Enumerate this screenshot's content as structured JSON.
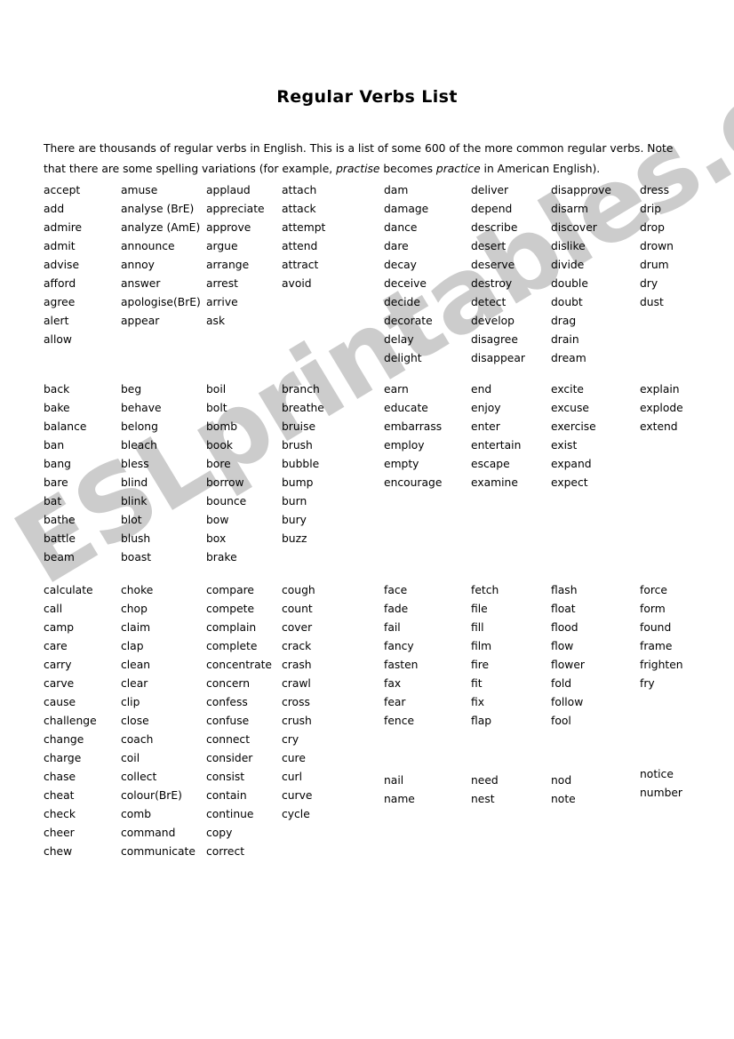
{
  "document": {
    "title": "Regular Verbs List",
    "intro": {
      "part1": "There are thousands of regular verbs in English. This is a list of some 600 of the more common regular verbs. Note that there are some spelling variations (for example, ",
      "italic1": "practise",
      "part2": " becomes ",
      "italic2": "practice",
      "part3": " in American English)."
    },
    "watermark": "ESLprintables.com",
    "watermark_color": "#cccccc"
  },
  "blocks": [
    {
      "id": "block-a",
      "columns": [
        [
          "accept",
          "add",
          "admire",
          "admit",
          "advise",
          "afford",
          "agree",
          "alert",
          "allow"
        ],
        [
          "amuse",
          "analyse (BrE)",
          "analyze (AmE)",
          "announce",
          "annoy",
          "answer",
          "apologise(BrE)",
          "appear"
        ],
        [
          "applaud",
          "appreciate",
          "approve",
          "argue",
          "arrange",
          "arrest",
          "arrive",
          "ask"
        ],
        [
          "attach",
          "attack",
          "attempt",
          "attend",
          "attract",
          "avoid"
        ],
        [
          "dam",
          "damage",
          "dance",
          "dare",
          "decay",
          "deceive",
          "decide",
          "decorate",
          "delay",
          "delight"
        ],
        [
          "deliver",
          "depend",
          "describe",
          "desert",
          "deserve",
          "destroy",
          "detect",
          "develop",
          "disagree",
          "disappear"
        ],
        [
          "disapprove",
          "disarm",
          "discover",
          "dislike",
          "divide",
          "double",
          "doubt",
          "drag",
          "drain",
          "dream"
        ],
        [
          "dress",
          "drip",
          "drop",
          "drown",
          "drum",
          "dry",
          "dust"
        ]
      ]
    },
    {
      "id": "block-b",
      "columns": [
        [
          "back",
          "bake",
          "balance",
          "ban",
          "bang",
          "bare",
          "bat",
          "bathe",
          "battle",
          "beam"
        ],
        [
          "beg",
          "behave",
          "belong",
          "bleach",
          "bless",
          "blind",
          "blink",
          "blot",
          "blush",
          "boast"
        ],
        [
          "boil",
          "bolt",
          "bomb",
          "book",
          "bore",
          "borrow",
          "bounce",
          "bow",
          "box",
          "brake"
        ],
        [
          "branch",
          "breathe",
          "bruise",
          "brush",
          "bubble",
          "bump",
          "burn",
          "bury",
          "buzz"
        ],
        [
          "earn",
          "educate",
          "embarrass",
          "employ",
          "empty",
          "encourage"
        ],
        [
          "end",
          "enjoy",
          "enter",
          "entertain",
          "escape",
          "examine"
        ],
        [
          "excite",
          "excuse",
          "exercise",
          "exist",
          "expand",
          "expect"
        ],
        [
          "explain",
          "explode",
          "extend"
        ]
      ]
    },
    {
      "id": "block-c",
      "columns": [
        [
          "calculate",
          "call",
          "camp",
          "care",
          "carry",
          "carve",
          "cause",
          "challenge",
          "change",
          "charge",
          "chase",
          "cheat",
          "check",
          "cheer",
          "chew"
        ],
        [
          "choke",
          "chop",
          "claim",
          "clap",
          "clean",
          "clear",
          "clip",
          "close",
          "coach",
          "coil",
          "collect",
          "colour(BrE)",
          "comb",
          "command",
          "communicate"
        ],
        [
          "compare",
          "compete",
          "complain",
          "complete",
          "concentrate",
          "concern",
          "confess",
          "confuse",
          "connect",
          "consider",
          "consist",
          "contain",
          "continue",
          "copy",
          "correct"
        ],
        [
          "cough",
          "count",
          "cover",
          "crack",
          "crash",
          "crawl",
          "cross",
          "crush",
          "cry",
          "cure",
          "curl",
          "curve",
          "cycle"
        ],
        [
          "face",
          "fade",
          "fail",
          "fancy",
          "fasten",
          "fax",
          "fear",
          "fence"
        ],
        [
          "fetch",
          "file",
          "fill",
          "film",
          "fire",
          "fit",
          "fix",
          "flap"
        ],
        [
          "flash",
          "float",
          "flood",
          "flow",
          "flower",
          "fold",
          "follow",
          "fool"
        ],
        [
          "force",
          "form",
          "found",
          "frame",
          "frighten",
          "fry"
        ]
      ]
    },
    {
      "id": "block-d",
      "columns": [
        [],
        [],
        [],
        [],
        [
          "nail",
          "name"
        ],
        [
          "need",
          "nest"
        ],
        [
          "nod",
          "note"
        ],
        [
          "notice",
          "number"
        ]
      ],
      "raised_column_index": 7
    }
  ]
}
